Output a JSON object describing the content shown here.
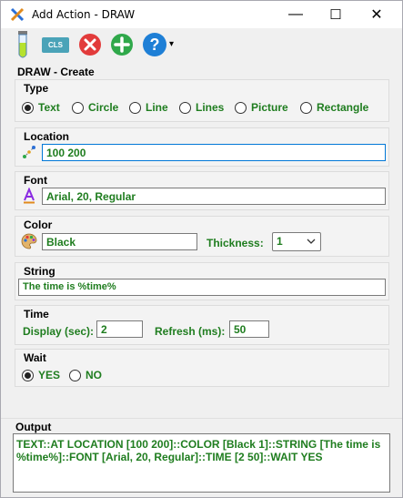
{
  "window": {
    "title": "Add Action - DRAW",
    "minimize": "—",
    "maximize": "☐",
    "close": "✕"
  },
  "toolbar": {
    "cls_label": "CLS",
    "help_label": "?",
    "dropdown_arrow": "▾"
  },
  "form": {
    "section_title": "DRAW - Create",
    "type": {
      "label": "Type",
      "options": [
        "Text",
        "Circle",
        "Line",
        "Lines",
        "Picture",
        "Rectangle"
      ],
      "selected": "Text"
    },
    "location": {
      "label": "Location",
      "value": "100 200"
    },
    "font": {
      "label": "Font",
      "value": "Arial, 20, Regular"
    },
    "color": {
      "label": "Color",
      "value": "Black",
      "thickness_label": "Thickness:",
      "thickness_value": "1"
    },
    "string": {
      "label": "String",
      "value": "The time is %time%"
    },
    "time": {
      "label": "Time",
      "display_label": "Display (sec):",
      "display_value": "2",
      "refresh_label": "Refresh (ms):",
      "refresh_value": "50"
    },
    "wait": {
      "label": "Wait",
      "options": [
        "YES",
        "NO"
      ],
      "selected": "YES"
    }
  },
  "output": {
    "label": "Output",
    "text": "TEXT::AT LOCATION [100 200]::COLOR [Black 1]::STRING [The time is %time%]::FONT [Arial, 20, Regular]::TIME [2 50]::WAIT YES"
  },
  "colors": {
    "accent_green": "#1f7d1f",
    "focus_blue": "#0078d7",
    "red_button": "#e23b3b",
    "green_button": "#2fa84a",
    "blue_button": "#1e7fd6",
    "cls_button": "#4aa3b8"
  }
}
